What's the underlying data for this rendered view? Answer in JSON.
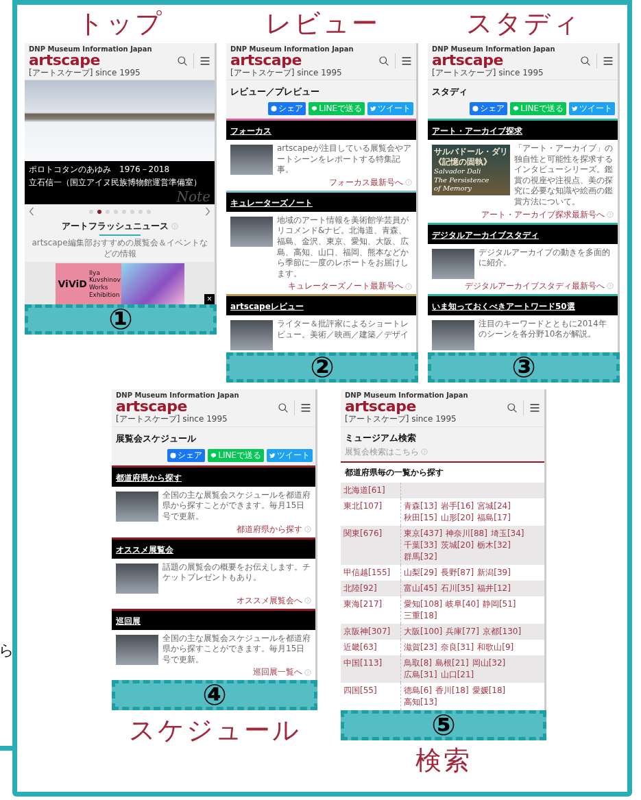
{
  "side_text": "ら",
  "top_row": [
    {
      "label": "トップ",
      "number": "①",
      "screen": {
        "kind": "top",
        "header": {
          "tagline": "DNP Museum Information Japan",
          "logo": "artscape",
          "subtitle": "[アートスケープ] since 1995"
        },
        "hero": {
          "caption_title": "ポロトコタンのあゆみ　1976－2018",
          "caption_sub": "立石信一（国立アイヌ民族博物館運営準備室）",
          "caption_mark": "Note"
        },
        "slides": [
          {
            "selected": false
          },
          {
            "selected": true
          },
          {
            "selected": false
          },
          {
            "selected": false
          },
          {
            "selected": false
          },
          {
            "selected": false
          },
          {
            "selected": false
          },
          {
            "selected": false
          }
        ],
        "news": {
          "heading": "アートフラッシュニュース",
          "description": "artscape編集部おすすめの展覧会＆イベントなどの情報"
        },
        "poster": {
          "title": "ViViD",
          "lines": [
            "Ilya",
            "Kuvshinov",
            "Works",
            "Exhibition"
          ],
          "close": "×"
        }
      }
    },
    {
      "label": "レビュー",
      "number": "②",
      "screen": {
        "kind": "sections",
        "header": {
          "tagline": "DNP Museum Information Japan",
          "logo": "artscape",
          "subtitle": "[アートスケープ] since 1995"
        },
        "title": "レビュー／プレビュー",
        "share_buttons": [
          {
            "kind": "facebook",
            "label": "シェア"
          },
          {
            "kind": "line",
            "label": "LINEで送る"
          },
          {
            "kind": "twitter",
            "label": "ツイート"
          }
        ],
        "sections": [
          {
            "heading": "フォーカス",
            "color": "#d2609a",
            "body": "artscapeが注目している展覧会やアートシーンをレポートする特集記事。",
            "link": "フォーカス最新号へ"
          },
          {
            "heading": "キュレーターズノート",
            "color": "#7cc4d6",
            "body": "地域のアート情報を美術館学芸員がリコメンド&ナビ。北海道、青森、福島、金沢、東京、愛知、大阪、広島、高知、山口、福岡、熊本などから季節に一度のレポートをお届けします。",
            "link": "キュレーターズノート最新号へ"
          },
          {
            "heading": "artscapeレビュー",
            "color": "#b59a5a",
            "body": "ライター＆批評家によるショートレビュー。美術／映画／建築／デザイ"
          }
        ]
      }
    },
    {
      "label": "スタディ",
      "number": "③",
      "screen": {
        "kind": "sections",
        "header": {
          "tagline": "DNP Museum Information Japan",
          "logo": "artscape",
          "subtitle": "[アートスケープ] since 1995"
        },
        "title": "スタディ",
        "share_buttons": [
          {
            "kind": "facebook",
            "label": "シェア"
          },
          {
            "kind": "line",
            "label": "LINEで送る"
          },
          {
            "kind": "twitter",
            "label": "ツイート"
          }
        ],
        "sections": [
          {
            "heading": "アート・アーカイブ探求",
            "color": "#2bb39a",
            "body": "「アート・アーカイブ」の独自性と可能性を探求するインタビューシリーズ。鑑賞の視座や注視点、美の探究に必要な知識や絵画の鑑賞方法について。",
            "link": "アート・アーカイブ探求最新号へ",
            "thumb_text": [
              "サルバドール・ダリ",
              "《記憶の固執》",
              "Salvador Dali",
              "The Persistence",
              "of Memory"
            ]
          },
          {
            "heading": "デジタルアーカイブスタディ",
            "color": "#2bb39a",
            "body": "デジタルアーカイブの動きを多面的に紹介。",
            "link": "デジタルアーカイブスタディ最新号へ"
          },
          {
            "heading": "いま知っておくべきアートワード50選",
            "color": "#2bb39a",
            "body": "注目のキーワードとともに2014年のシーンを各分野10名が解説。"
          }
        ]
      }
    }
  ],
  "bottom_row": [
    {
      "label": "スケジュール",
      "number": "④",
      "screen": {
        "kind": "sections",
        "header": {
          "tagline": "DNP Museum Information Japan",
          "logo": "artscape",
          "subtitle": "[アートスケープ] since 1995"
        },
        "title": "展覧会スケジュール",
        "share_buttons": [
          {
            "kind": "facebook",
            "label": "シェア"
          },
          {
            "kind": "line",
            "label": "LINEで送る"
          },
          {
            "kind": "twitter",
            "label": "ツイート"
          }
        ],
        "sections": [
          {
            "heading": "都道府県から探す",
            "color": "#8e1b24",
            "body": "全国の主な展覧会スケジュールを都道府県から探すことができます。毎月15日号で更新。",
            "link": "都道府県から探す"
          },
          {
            "heading": "オススメ展覧会",
            "color": "#8e1b24",
            "body": "話題の展覧会の概要をお伝えします。チケットプレゼントもあり。",
            "link": "オススメ展覧会へ"
          },
          {
            "heading": "巡回展",
            "color": "#8e1b24",
            "body": "全国の主な展覧会スケジュールを都道府県から探すことができます。毎月15日号で更新。",
            "link": "巡回展一覧へ"
          }
        ]
      }
    },
    {
      "label": "検索",
      "number": "⑤",
      "screen": {
        "kind": "search",
        "header": {
          "tagline": "DNP Museum Information Japan",
          "logo": "artscape",
          "subtitle": "[アートスケープ] since 1995"
        },
        "title": "ミュージアム検索",
        "sublink": "展覧会検索はこちら",
        "heading": "都道府県毎の一覧から探す",
        "rows": [
          {
            "region": "北海道[61]",
            "prefectures": []
          },
          {
            "region": "東北[107]",
            "prefectures": [
              "青森[13]",
              "岩手[16]",
              "宮城[24]",
              "秋田[15]",
              "山形[20]",
              "福島[17]"
            ]
          },
          {
            "region": "関東[676]",
            "prefectures": [
              "東京[437]",
              "神奈川[88]",
              "埼玉[34]",
              "千葉[33]",
              "茨城[20]",
              "栃木[32]",
              "群馬[32]"
            ]
          },
          {
            "region": "甲信越[155]",
            "prefectures": [
              "山梨[29]",
              "長野[87]",
              "新潟[39]"
            ]
          },
          {
            "region": "北陸[92]",
            "prefectures": [
              "富山[45]",
              "石川[35]",
              "福井[12]"
            ]
          },
          {
            "region": "東海[217]",
            "prefectures": [
              "愛知[108]",
              "岐阜[40]",
              "静岡[51]",
              "三重[18]"
            ]
          },
          {
            "region": "京阪神[307]",
            "prefectures": [
              "大阪[100]",
              "兵庫[77]",
              "京都[130]"
            ]
          },
          {
            "region": "近畿[63]",
            "prefectures": [
              "滋賀[23]",
              "奈良[31]",
              "和歌山[9]"
            ]
          },
          {
            "region": "中国[113]",
            "prefectures": [
              "鳥取[8]",
              "島根[21]",
              "岡山[32]",
              "広島[31]",
              "山口[21]"
            ]
          },
          {
            "region": "四国[55]",
            "prefectures": [
              "徳島[6]",
              "香川[18]",
              "愛媛[18]",
              "高知[13]"
            ]
          }
        ]
      }
    }
  ]
}
